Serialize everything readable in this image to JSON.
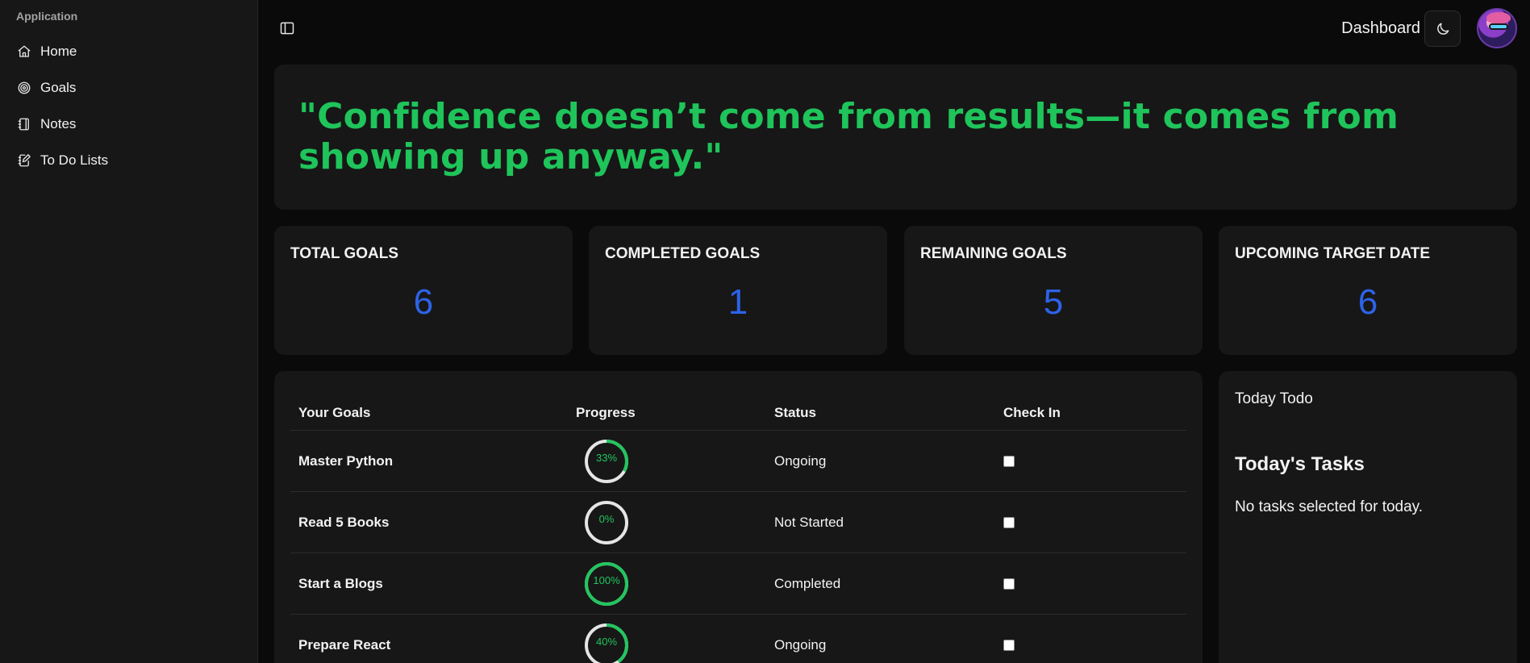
{
  "sidebar": {
    "group_label": "Application",
    "items": [
      {
        "label": "Home",
        "icon": "home-icon"
      },
      {
        "label": "Goals",
        "icon": "target-icon"
      },
      {
        "label": "Notes",
        "icon": "notebook-icon"
      },
      {
        "label": "To Do Lists",
        "icon": "notebook-pen-icon"
      }
    ]
  },
  "header": {
    "title": "Dashboard",
    "theme_icon": "moon-icon"
  },
  "quote": {
    "text": "\"Confidence doesn’t come from results—it comes from showing up anyway.\"",
    "color": "#1fc45a"
  },
  "stats": [
    {
      "title": "TOTAL GOALS",
      "value": "6"
    },
    {
      "title": "COMPLETED GOALS",
      "value": "1"
    },
    {
      "title": "REMAINING GOALS",
      "value": "5"
    },
    {
      "title": "UPCOMING TARGET DATE",
      "value": "6"
    }
  ],
  "goals_table": {
    "headers": [
      "Your Goals",
      "Progress",
      "Status",
      "Check In"
    ],
    "rows": [
      {
        "name": "Master Python",
        "progress": 33,
        "progress_label": "33%",
        "status": "Ongoing",
        "checked": false
      },
      {
        "name": "Read 5 Books",
        "progress": 0,
        "progress_label": "0%",
        "status": "Not Started",
        "checked": false
      },
      {
        "name": "Start a Blogs",
        "progress": 100,
        "progress_label": "100%",
        "status": "Completed",
        "checked": false
      },
      {
        "name": "Prepare React",
        "progress": 40,
        "progress_label": "40%",
        "status": "Ongoing",
        "checked": false
      }
    ]
  },
  "todo": {
    "label": "Today Todo",
    "heading": "Today's Tasks",
    "empty_message": "No tasks selected for today."
  },
  "colors": {
    "accent_blue": "#2d63e9",
    "progress_green": "#22c55e",
    "progress_track": "#e5e5e5"
  }
}
